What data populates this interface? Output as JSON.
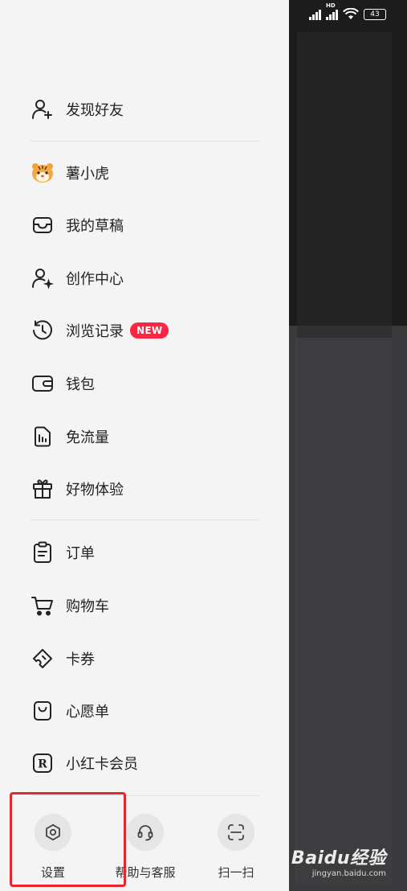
{
  "status_bar": {
    "network_label": "HD",
    "battery": "43"
  },
  "menu": {
    "items": [
      {
        "label": "发现好友",
        "icon": "add-friend-icon"
      },
      {
        "label": "薯小虎",
        "icon": "tiger-mascot-icon"
      },
      {
        "label": "我的草稿",
        "icon": "drafts-tray-icon"
      },
      {
        "label": "创作中心",
        "icon": "creator-center-icon"
      },
      {
        "label": "浏览记录",
        "icon": "history-clock-icon",
        "badge": "NEW"
      },
      {
        "label": "钱包",
        "icon": "wallet-icon"
      },
      {
        "label": "免流量",
        "icon": "data-free-icon"
      },
      {
        "label": "好物体验",
        "icon": "gift-icon"
      },
      {
        "label": "订单",
        "icon": "order-clipboard-icon"
      },
      {
        "label": "购物车",
        "icon": "shopping-cart-icon"
      },
      {
        "label": "卡券",
        "icon": "coupon-icon"
      },
      {
        "label": "心愿单",
        "icon": "wishlist-bag-icon"
      },
      {
        "label": "小红卡会员",
        "icon": "red-card-member-icon"
      }
    ]
  },
  "bottom_bar": {
    "settings": "设置",
    "help": "帮助与客服",
    "scan": "扫一扫"
  },
  "watermark": {
    "main": "Baidu经验",
    "sub": "jingyan.baidu.com"
  },
  "colors": {
    "badge": "#ff2442",
    "highlight": "#e8262b",
    "drawer_bg": "#f4f4f4"
  }
}
